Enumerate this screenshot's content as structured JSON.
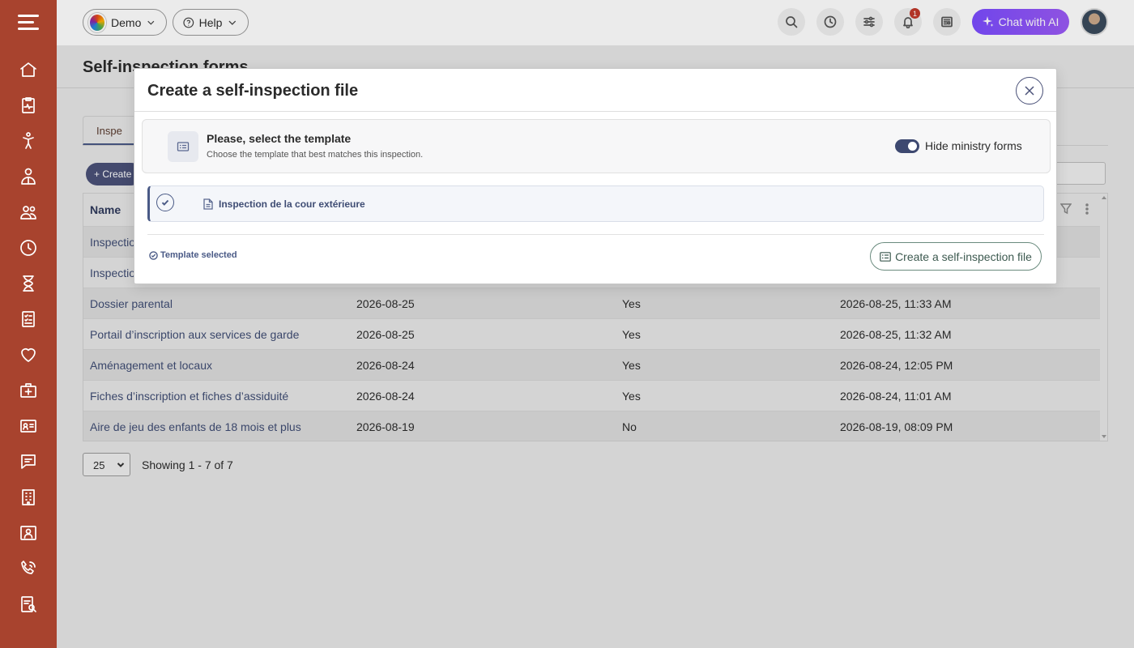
{
  "topbar": {
    "demo_label": "Demo",
    "help_label": "Help",
    "notification_count": "1",
    "ai_button_label": "Chat with AI"
  },
  "page": {
    "title": "Self-inspection forms",
    "tab_label": "Inspe",
    "create_label": "Create",
    "table": {
      "header_name": "Name",
      "rows": [
        {
          "name": "Inspection",
          "date": "",
          "active": "",
          "modified": ""
        },
        {
          "name": "Inspection",
          "date": "",
          "active": "",
          "modified": ""
        },
        {
          "name": "Dossier parental",
          "date": "2026-08-25",
          "active": "Yes",
          "modified": "2026-08-25, 11:33 AM"
        },
        {
          "name": "Portail d’inscription aux services de garde",
          "date": "2026-08-25",
          "active": "Yes",
          "modified": "2026-08-25, 11:32 AM"
        },
        {
          "name": "Aménagement et locaux",
          "date": "2026-08-24",
          "active": "Yes",
          "modified": "2026-08-24, 12:05 PM"
        },
        {
          "name": "Fiches d’inscription et fiches d’assiduité",
          "date": "2026-08-24",
          "active": "Yes",
          "modified": "2026-08-24, 11:01 AM"
        },
        {
          "name": "Aire de jeu des enfants de 18 mois et plus",
          "date": "2026-08-19",
          "active": "No",
          "modified": "2026-08-19, 08:09 PM"
        }
      ]
    },
    "page_size": "25",
    "showing": "Showing 1 - 7 of 7"
  },
  "modal": {
    "title": "Create a self-inspection file",
    "template_heading": "Please, select the template",
    "template_sub": "Choose the template that best matches this inspection.",
    "toggle_label": "Hide ministry forms",
    "toggle_on": true,
    "option_label": "Inspection de la cour extérieure",
    "selected_note": "Template selected",
    "submit_label": "Create a self-inspection file"
  },
  "colors": {
    "sidebar": "#a8432e",
    "accent": "#4a5178",
    "ai_gradient_start": "#7b4dff",
    "ai_gradient_end": "#9b59f5"
  }
}
